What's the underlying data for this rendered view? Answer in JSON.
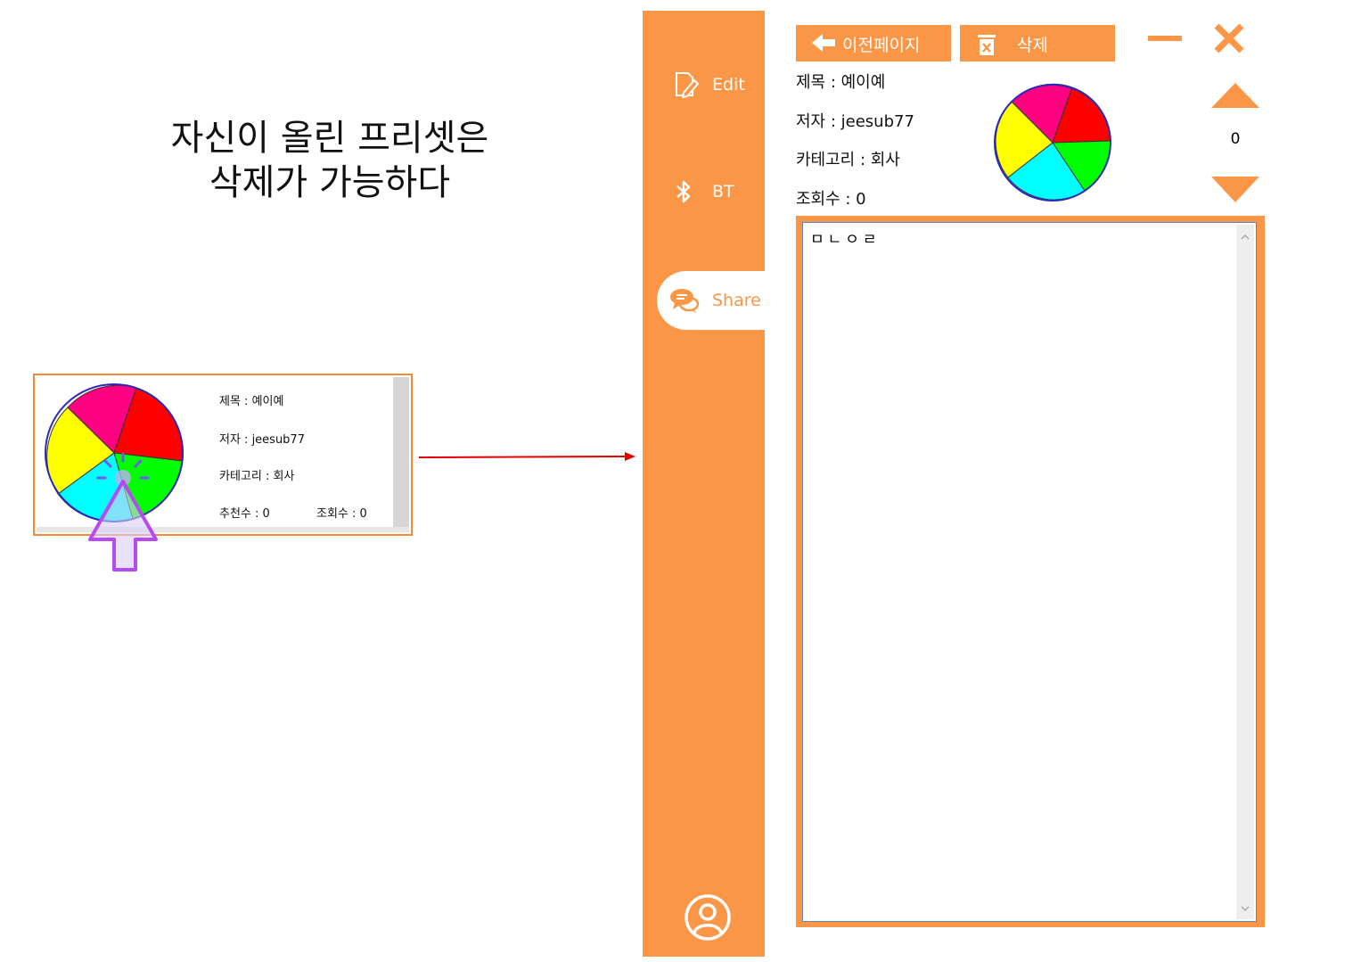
{
  "caption": {
    "line1": "자신이 올린 프리셋은",
    "line2": "삭제가 가능하다"
  },
  "card": {
    "title": "제목 : 예이예",
    "author": "저자 : jeesub77",
    "category": "카테고리 : 회사",
    "recommend": "추천수 : 0",
    "views": "조회수 : 0"
  },
  "pie_colors": [
    "#ff0080",
    "#ff0000",
    "#00ff00",
    "#00ffff",
    "#ffff00"
  ],
  "sidebar": {
    "items": [
      {
        "label": "Edit",
        "icon": "edit-icon"
      },
      {
        "label": "BT",
        "icon": "bluetooth-icon"
      },
      {
        "label": "Share",
        "icon": "share-chat-icon"
      }
    ],
    "profile_icon": "user-profile-icon",
    "accent": "#fb9647"
  },
  "toolbar": {
    "prev_label": "이전페이지",
    "delete_label": "삭제",
    "count": "0"
  },
  "detail": {
    "title": "제목 : 예이예",
    "author": "저자 : jeesub77",
    "category": "카테고리 : 회사",
    "views": "조회수 : 0",
    "content": "ㅁㄴㅇㄹ"
  }
}
